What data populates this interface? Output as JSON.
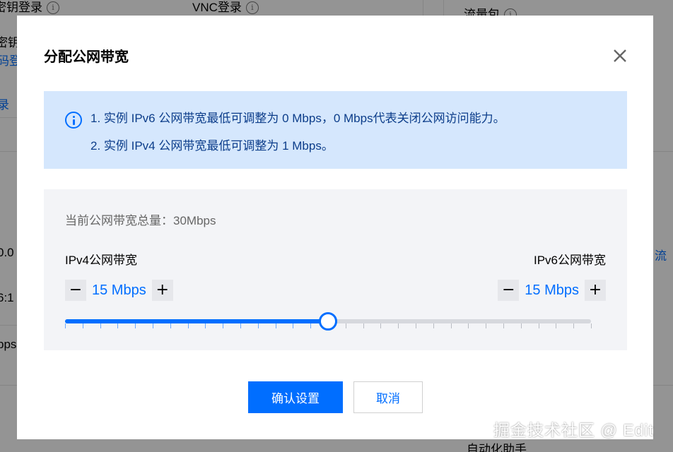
{
  "background": {
    "key_login": "密钥登录",
    "vnc_login": "VNC登录",
    "traffic_pack": "流量包",
    "key_partial": "密钥",
    "pwd_partial": "码登",
    "login_link": "录",
    "ip_partial": "0.0",
    "ip_partial2": "6:1",
    "bps_partial": "bps",
    "right_link": "流",
    "bottom_partial": "自动化助手",
    "info_glyph": "i"
  },
  "dialog": {
    "title": "分配公网带宽",
    "notice": {
      "line1": "1. 实例 IPv6 公网带宽最低可调整为 0 Mbps，0 Mbps代表关闭公网访问能力。",
      "line2": "2. 实例 IPv4 公网带宽最低可调整为 1 Mbps。"
    },
    "total_label": "当前公网带宽总量：30Mbps",
    "ipv4": {
      "label": "IPv4公网带宽",
      "value": "15 Mbps",
      "minus": "−",
      "plus": "+"
    },
    "ipv6": {
      "label": "IPv6公网带宽",
      "value": "15 Mbps",
      "minus": "−",
      "plus": "+"
    },
    "slider": {
      "total": 30,
      "ipv4_share": 15,
      "tick_count": 30,
      "fill_color": "#006eff"
    },
    "confirm_label": "确认设置",
    "cancel_label": "取消"
  },
  "watermark": "掘金技术社区 @ Edit",
  "colors": {
    "accent": "#006eff",
    "notice_bg": "#d5e7fd",
    "panel_bg": "#f3f4f7"
  }
}
